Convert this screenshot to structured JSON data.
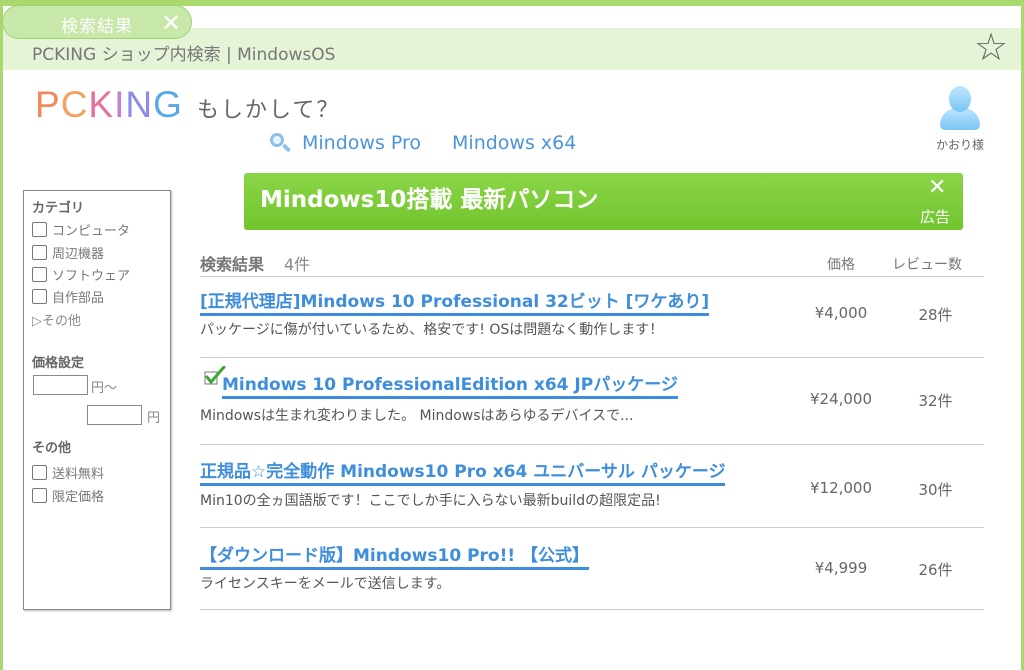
{
  "tab": {
    "label": "検索結果"
  },
  "address": {
    "text": "PCKING ショップ内検索 | MindowsOS"
  },
  "logo": {
    "letters": [
      "P",
      "C",
      "K",
      "I",
      "N",
      "G"
    ]
  },
  "suggest": {
    "heading": "もしかして？",
    "links": [
      "Mindows Pro",
      "Mindows x64"
    ]
  },
  "user": {
    "name": "かおり様"
  },
  "ad": {
    "title": "Mindows10搭載 最新パソコン",
    "label": "広告"
  },
  "sidebar": {
    "category_heading": "カテゴリ",
    "categories": [
      "コンピュータ",
      "周辺機器",
      "ソフトウェア",
      "自作部品"
    ],
    "other_link": "▷その他",
    "price_heading": "価格設定",
    "price_unit_from": "円〜",
    "price_unit_to": "円",
    "other_heading": "その他",
    "others": [
      "送料無料",
      "限定価格"
    ]
  },
  "results": {
    "heading": "検索結果",
    "count": "4件",
    "col_price": "価格",
    "col_review": "レビュー数",
    "items": [
      {
        "title": "[正規代理店]Mindows 10 Professional 32ビット [ワケあり]",
        "desc": "パッケージに傷が付いているため、格安です! OSは問題なく動作します！",
        "price": "¥4,000",
        "reviews": "28件",
        "checked": false
      },
      {
        "title": "Mindows 10 ProfessionalEdition x64 JPパッケージ",
        "desc": "Mindowsは生まれ変わりました。 Mindowsはあらゆるデバイスで...",
        "price": "¥24,000",
        "reviews": "32件",
        "checked": true
      },
      {
        "title": "正規品☆完全動作 Mindows10 Pro x64 ユニバーサル パッケージ",
        "desc": "Min10の全ヵ国語版です！ここでしか手に入らない最新buildの超限定品!",
        "price": "¥12,000",
        "reviews": "30件",
        "checked": false
      },
      {
        "title": "【ダウンロード版】Mindows10 Pro!! 【公式】",
        "desc": "ライセンスキーをメールで送信します。",
        "price": "¥4,999",
        "reviews": "26件",
        "checked": false
      }
    ]
  }
}
